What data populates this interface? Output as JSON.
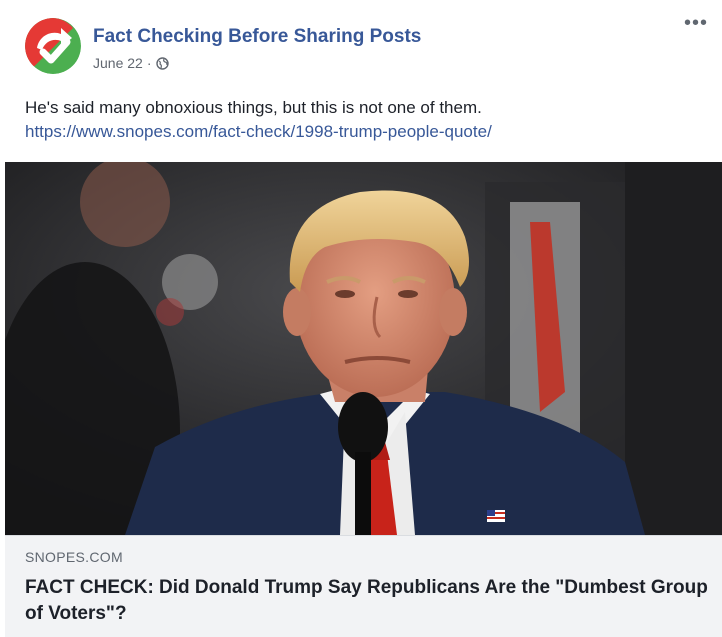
{
  "post": {
    "page_name": "Fact Checking Before Sharing Posts",
    "date": "June 22",
    "separator": "·",
    "more_label": "•••",
    "message": "He's said many obnoxious things, but this is not one of them.",
    "url": "https://www.snopes.com/fact-check/1998-trump-people-quote/"
  },
  "link_preview": {
    "domain": "SNOPES.COM",
    "title": "FACT CHECK: Did Donald Trump Say Republicans Are the \"Dumbest Group of Voters\"?"
  },
  "colors": {
    "link_blue": "#385898",
    "avatar_red": "#e53935",
    "avatar_green": "#4caf50"
  },
  "icons": {
    "avatar": "red-green-checkmark-logo",
    "audience": "globe-icon",
    "more": "ellipsis-icon"
  }
}
